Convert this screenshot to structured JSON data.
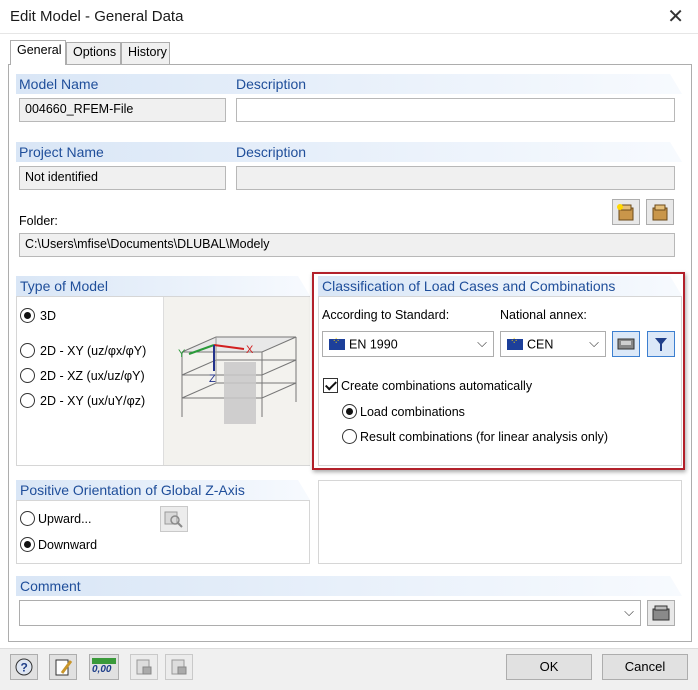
{
  "window": {
    "title": "Edit Model - General Data"
  },
  "tabs": [
    {
      "label": "General"
    },
    {
      "label": "Options"
    },
    {
      "label": "History"
    }
  ],
  "model": {
    "name_label": "Model Name",
    "name_value": "004660_RFEM-File",
    "desc_label": "Description",
    "desc_value": ""
  },
  "project": {
    "name_label": "Project Name",
    "name_value": "Not identified",
    "desc_label": "Description",
    "desc_value": ""
  },
  "folder": {
    "label": "Folder:",
    "path": "C:\\Users\\mfise\\Documents\\DLUBAL\\Modely"
  },
  "type_of_model": {
    "title": "Type of Model",
    "options": [
      {
        "label": "3D",
        "selected": true
      },
      {
        "label": "2D - XY (uz/φx/φY)",
        "selected": false
      },
      {
        "label": "2D - XZ (ux/uz/φY)",
        "selected": false
      },
      {
        "label": "2D - XY (ux/uY/φz)",
        "selected": false
      }
    ],
    "axes": {
      "y": "Y",
      "x": "X",
      "z": "Z"
    }
  },
  "classification": {
    "title": "Classification of Load Cases and Combinations",
    "standard_label": "According to Standard:",
    "standard_value": "EN 1990",
    "annex_label": "National annex:",
    "annex_value": "CEN",
    "create_label": "Create combinations automatically",
    "create_checked": true,
    "options": [
      {
        "label": "Load combinations",
        "selected": true
      },
      {
        "label": "Result combinations (for linear analysis only)",
        "selected": false
      }
    ]
  },
  "orientation": {
    "title": "Positive Orientation of Global Z-Axis",
    "options": [
      {
        "label": "Upward...",
        "selected": false
      },
      {
        "label": "Downward",
        "selected": true
      }
    ]
  },
  "comment": {
    "title": "Comment",
    "value": ""
  },
  "toolbar": {
    "zero_label": "0,00"
  },
  "buttons": {
    "ok": "OK",
    "cancel": "Cancel"
  }
}
